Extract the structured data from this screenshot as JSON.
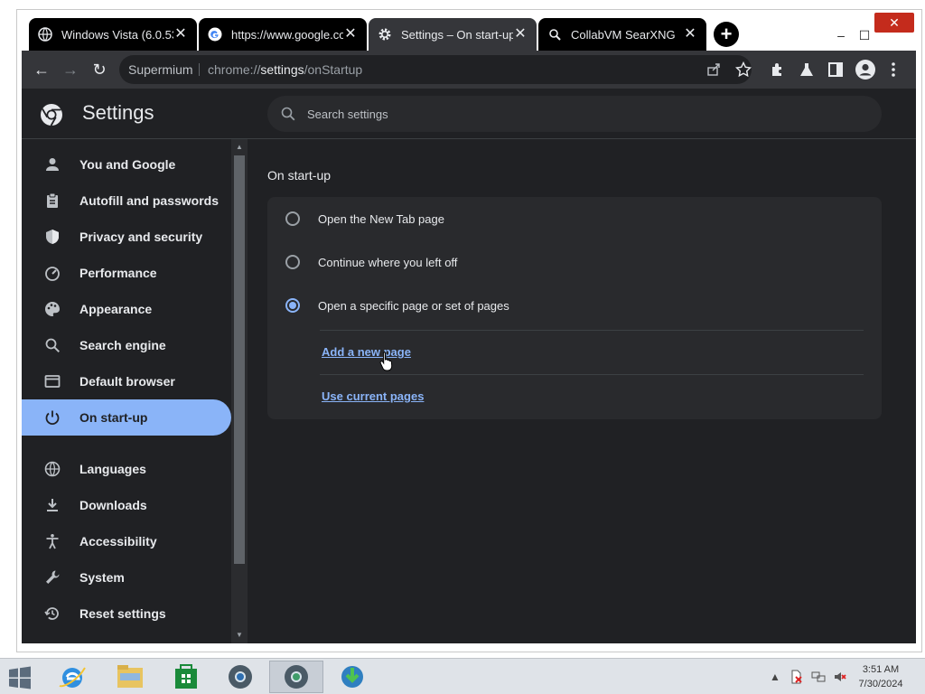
{
  "browser": {
    "tabs": [
      {
        "title": "Windows Vista (6.0.53"
      },
      {
        "title": "https://www.google.co"
      },
      {
        "title": "Settings – On start-up"
      },
      {
        "title": "CollabVM SearXNG"
      }
    ],
    "close_glyph": "✕",
    "new_tab_glyph": "+",
    "window_controls": {
      "minimize": "–",
      "maximize": "☐",
      "close": "✕"
    },
    "toolbar": {
      "back": "←",
      "forward": "→",
      "reload": "↻",
      "site_name": "Supermium",
      "url_prefix": "chrome://",
      "url_host": "settings",
      "url_path": "/onStartup"
    }
  },
  "settings": {
    "title": "Settings",
    "search_placeholder": "Search settings",
    "nav": [
      {
        "label": "You and Google",
        "icon": "person-icon"
      },
      {
        "label": "Autofill and passwords",
        "icon": "clipboard-icon"
      },
      {
        "label": "Privacy and security",
        "icon": "shield-icon"
      },
      {
        "label": "Performance",
        "icon": "speedometer-icon"
      },
      {
        "label": "Appearance",
        "icon": "palette-icon"
      },
      {
        "label": "Search engine",
        "icon": "search-icon"
      },
      {
        "label": "Default browser",
        "icon": "browser-window-icon"
      },
      {
        "label": "On start-up",
        "icon": "power-icon",
        "selected": true
      },
      {
        "label": "Languages",
        "icon": "globe-icon"
      },
      {
        "label": "Downloads",
        "icon": "download-icon"
      },
      {
        "label": "Accessibility",
        "icon": "accessibility-icon"
      },
      {
        "label": "System",
        "icon": "wrench-icon"
      },
      {
        "label": "Reset settings",
        "icon": "history-icon"
      }
    ],
    "on_startup": {
      "section_title": "On start-up",
      "options": [
        {
          "label": "Open the New Tab page",
          "checked": false
        },
        {
          "label": "Continue where you left off",
          "checked": false
        },
        {
          "label": "Open a specific page or set of pages",
          "checked": true
        }
      ],
      "add_page_link": "Add a new page",
      "use_current_link": "Use current pages"
    }
  },
  "taskbar": {
    "clock_time": "3:51 AM",
    "clock_date": "7/30/2024"
  },
  "colors": {
    "accent": "#8ab4f8",
    "page_bg": "#202124",
    "card_bg": "#292a2d",
    "toolbar_bg": "#35363a"
  }
}
